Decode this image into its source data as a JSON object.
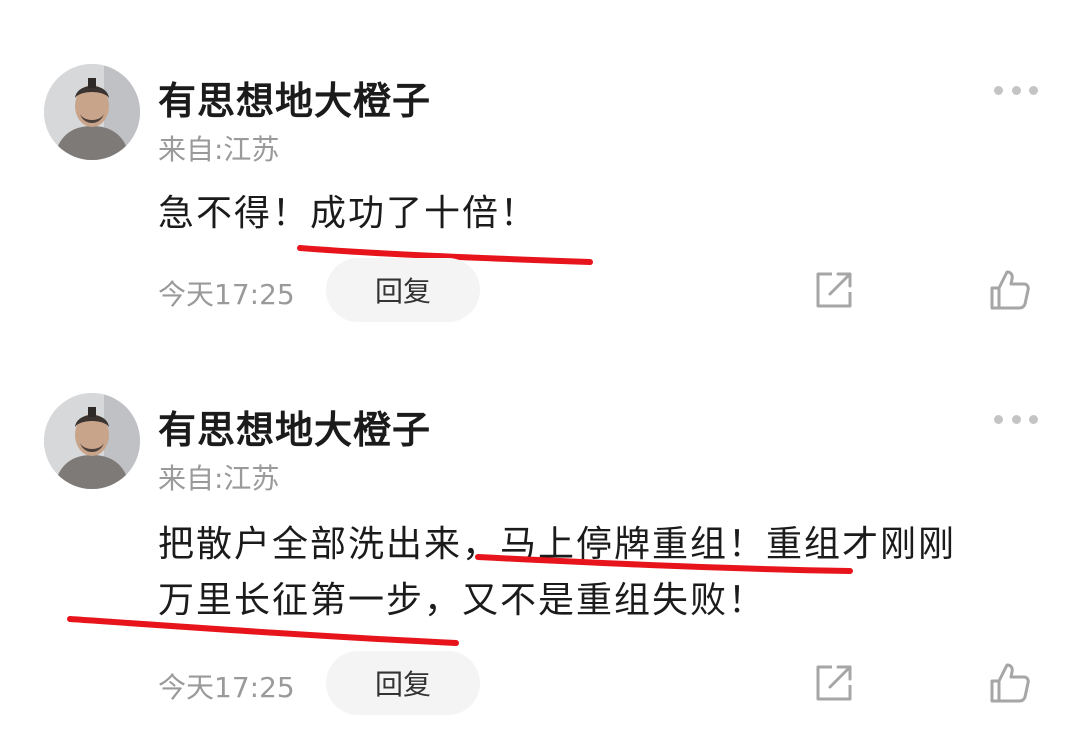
{
  "comments": [
    {
      "username": "有思想地大橙子",
      "location": "来自:江苏",
      "lines": [
        "急不得！成功了十倍！"
      ],
      "time": "今天17:25",
      "reply_label": "回复",
      "icons": {
        "more": "more-dots-icon",
        "share": "share-icon",
        "like": "thumbs-up-icon"
      }
    },
    {
      "username": "有思想地大橙子",
      "location": "来自:江苏",
      "lines": [
        "把散户全部洗出来，马上停牌重组！重组才刚刚",
        "万里长征第一步，又不是重组失败！"
      ],
      "time": "今天17:25",
      "reply_label": "回复",
      "icons": {
        "more": "more-dots-icon",
        "share": "share-icon",
        "like": "thumbs-up-icon"
      }
    }
  ],
  "colors": {
    "underline": "#e8141c",
    "meta_text": "#9a9a9a",
    "reply_bg": "#f4f4f4"
  }
}
